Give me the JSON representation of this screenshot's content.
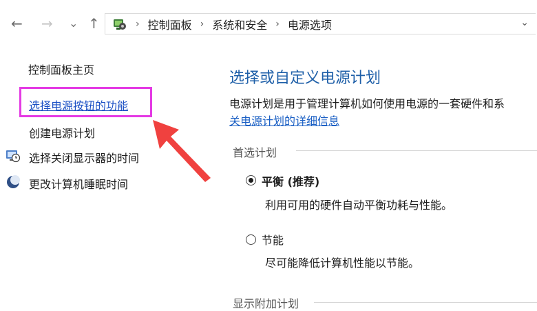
{
  "nav": {
    "back_glyph": "←",
    "forward_glyph": "→",
    "recent_glyph": "⌄",
    "up_glyph": "↑"
  },
  "address": {
    "sep": "›",
    "crumbs": [
      "控制面板",
      "系统和安全",
      "电源选项"
    ],
    "dropdown_glyph": "⌄"
  },
  "sidebar": {
    "home": "控制面板主页",
    "items": [
      {
        "label": "选择电源按钮的功能",
        "icon": ""
      },
      {
        "label": "创建电源计划",
        "icon": ""
      },
      {
        "label": "选择关闭显示器的时间",
        "icon": "monitor-clock-icon"
      },
      {
        "label": "更改计算机睡眠时间",
        "icon": "moon-sleep-icon"
      }
    ]
  },
  "main": {
    "title": "选择或自定义电源计划",
    "description": "电源计划是用于管理计算机如何使用电源的一套硬件和系",
    "details_link": "关电源计划的详细信息",
    "preferred_group": "首选计划",
    "plans": [
      {
        "name": "平衡 (推荐)",
        "desc": "利用可用的硬件自动平衡功耗与性能。",
        "selected": true
      },
      {
        "name": "节能",
        "desc": "尽可能降低计算机性能以节能。",
        "selected": false
      }
    ],
    "additional_group": "显示附加计划"
  },
  "colors": {
    "highlight_box": "#e43ae4",
    "annotation_arrow": "#f0413f",
    "link_blue": "#1a5fc4",
    "title_blue": "#1e5fa8"
  }
}
